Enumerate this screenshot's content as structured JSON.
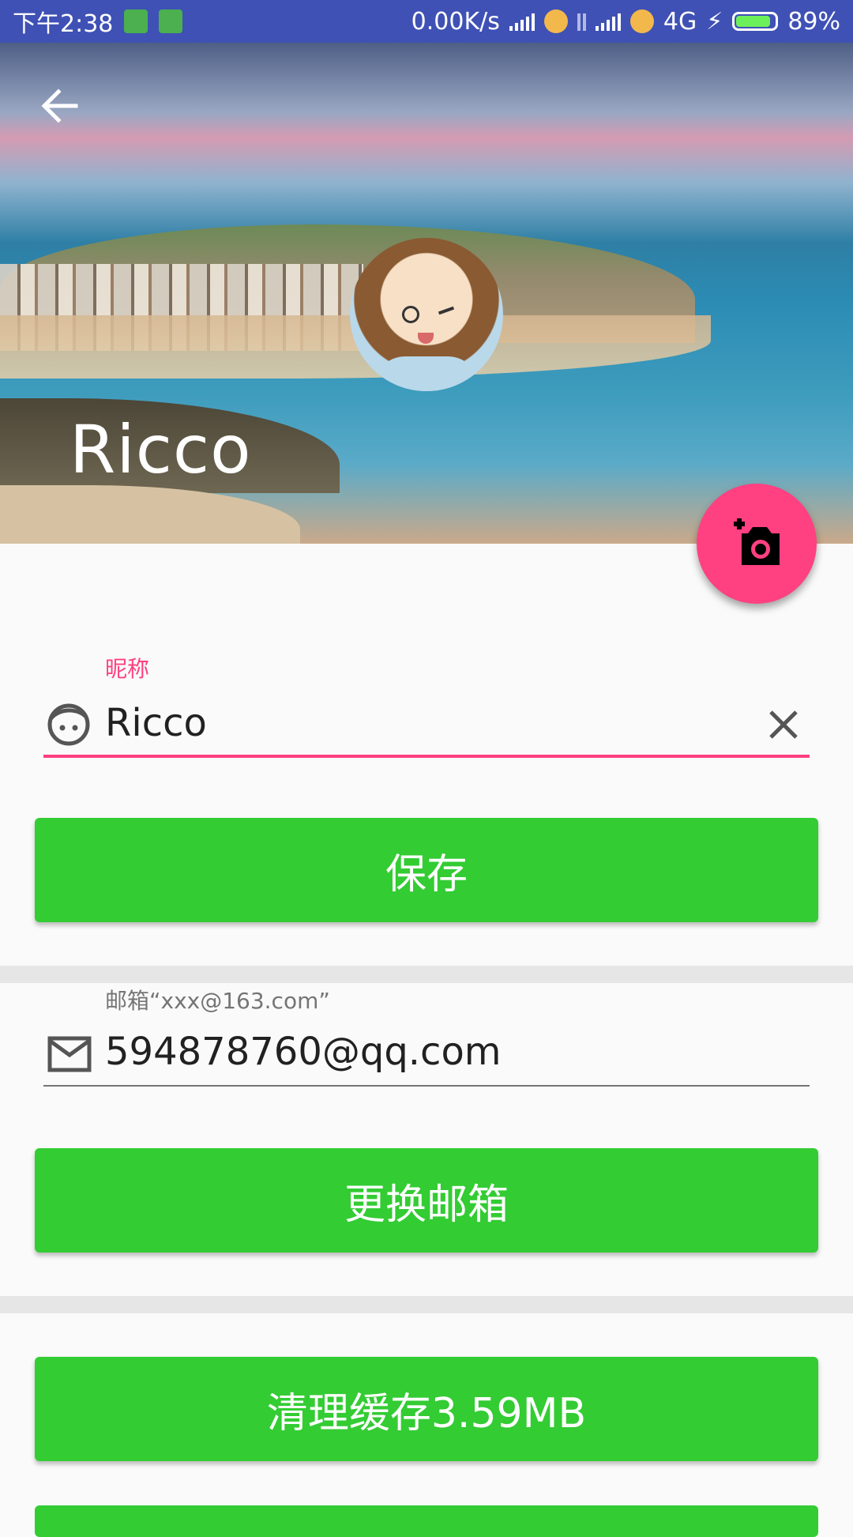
{
  "status_bar": {
    "time": "下午2:38",
    "net_speed": "0.00K/s",
    "network": "4G",
    "battery_percent": "89%",
    "battery_level": 0.89
  },
  "header": {
    "back_icon": "arrow-back-icon",
    "user_name": "Ricco",
    "fab_icon": "add-a-photo-icon",
    "fab_color": "#ff4081"
  },
  "nickname": {
    "label": "昵称",
    "value": "Ricco",
    "icon": "face-icon",
    "clear_icon": "close-icon",
    "accent": "#ff4081"
  },
  "save_button": {
    "label": "保存"
  },
  "email": {
    "label": "邮箱“xxx@163.com”",
    "value": "594878760@qq.com",
    "icon": "mail-icon"
  },
  "change_email_button": {
    "label": "更换邮箱"
  },
  "clear_cache_button": {
    "label": "清理缓存3.59MB"
  },
  "button_color": "#33cc33"
}
